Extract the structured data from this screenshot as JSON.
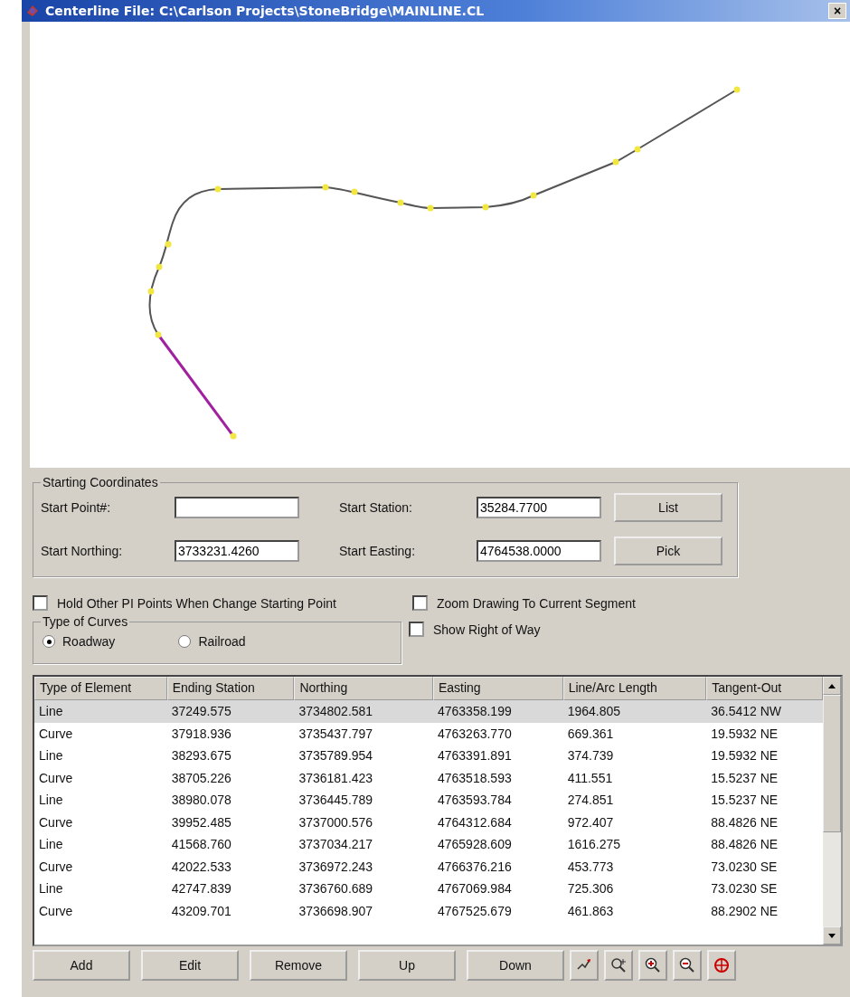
{
  "window": {
    "title": "Centerline File: C:\\Carlson Projects\\StoneBridge\\MAINLINE.CL",
    "close": "×"
  },
  "starting_coordinates": {
    "title": "Starting Coordinates",
    "fields": [
      {
        "label": "Start Point#:"
      },
      {
        "label": "Start Station:",
        "value": "35284.7700"
      },
      {
        "label": "Start Northing:",
        "value": "3733231.4260"
      },
      {
        "label": "Start Easting:",
        "value": "4764538.0000"
      }
    ],
    "buttons": [
      "List",
      "Pick"
    ]
  },
  "options": [
    {
      "label": "Hold Other PI Points When Change Starting Point",
      "checked": false
    },
    {
      "label": "Zoom Drawing To Current Segment",
      "checked": false
    },
    {
      "label": "Show Right of Way",
      "checked": false
    }
  ],
  "type_of_curves": {
    "title": "Type of Curves",
    "choices": [
      {
        "label": "Roadway",
        "selected": true
      },
      {
        "label": "Railroad",
        "selected": false
      }
    ]
  },
  "table": {
    "columns": [
      "Type of Element",
      "Ending Station",
      "Northing",
      "Easting",
      "Line/Arc Length",
      "Tangent-Out"
    ],
    "rows": [
      {
        "selected": true,
        "cells": [
          "Line",
          "37249.575",
          "3734802.581",
          "4763358.199",
          "1964.805",
          "36.5412 NW"
        ]
      },
      {
        "selected": false,
        "cells": [
          "Curve",
          "37918.936",
          "3735437.797",
          "4763263.770",
          "669.361",
          "19.5932 NE"
        ]
      },
      {
        "selected": false,
        "cells": [
          "Line",
          "38293.675",
          "3735789.954",
          "4763391.891",
          "374.739",
          "19.5932 NE"
        ]
      },
      {
        "selected": false,
        "cells": [
          "Curve",
          "38705.226",
          "3736181.423",
          "4763518.593",
          "411.551",
          "15.5237 NE"
        ]
      },
      {
        "selected": false,
        "cells": [
          "Line",
          "38980.078",
          "3736445.789",
          "4763593.784",
          "274.851",
          "15.5237 NE"
        ]
      },
      {
        "selected": false,
        "cells": [
          "Curve",
          "39952.485",
          "3737000.576",
          "4764312.684",
          "972.407",
          "88.4826 NE"
        ]
      },
      {
        "selected": false,
        "cells": [
          "Line",
          "41568.760",
          "3737034.217",
          "4765928.609",
          "1616.275",
          "88.4826 NE"
        ]
      },
      {
        "selected": false,
        "cells": [
          "Curve",
          "42022.533",
          "3736972.243",
          "4766376.216",
          "453.773",
          "73.0230 SE"
        ]
      },
      {
        "selected": false,
        "cells": [
          "Line",
          "42747.839",
          "3736760.689",
          "4767069.984",
          "725.306",
          "73.0230 SE"
        ]
      },
      {
        "selected": false,
        "cells": [
          "Curve",
          "43209.701",
          "3736698.907",
          "4767525.679",
          "461.863",
          "88.2902 NE"
        ]
      }
    ]
  },
  "buttons": [
    "Add",
    "Edit",
    "Remove",
    "Up",
    "Down"
  ],
  "tool_buttons": [
    {
      "kind": "pick"
    },
    {
      "kind": "zoom-extents"
    },
    {
      "kind": "zoom-in"
    },
    {
      "kind": "zoom-out"
    },
    {
      "kind": "center"
    }
  ]
}
